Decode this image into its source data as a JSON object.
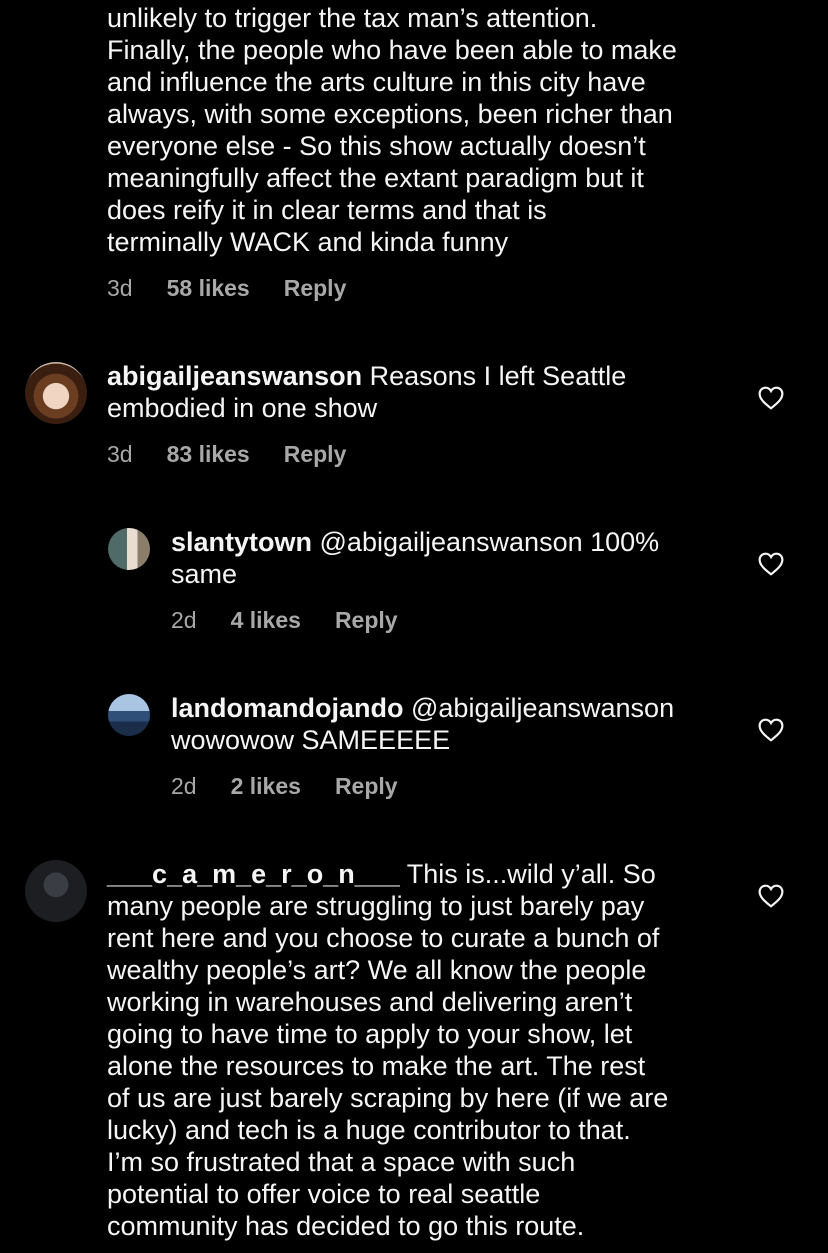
{
  "comments": [
    {
      "text": "unlikely to trigger the tax man’s attention.\nFinally, the people who have been able to make\nand influence the arts culture in this city have\nalways, with some exceptions, been richer than\neveryone else - So this show actually doesn’t\nmeaningfully affect the extant paradigm but it\ndoes reify it in clear terms and that is\nterminally WACK and kinda funny",
      "time": "3d",
      "likes": "58 likes",
      "reply": "Reply"
    },
    {
      "username": "abigailjeanswanson",
      "text": " Reasons I left Seattle\nembodied in one show",
      "time": "3d",
      "likes": "83 likes",
      "reply": "Reply",
      "icon": "heart-outline-icon"
    },
    {
      "username": "slantytown",
      "text": " @abigailjeanswanson 100%\nsame",
      "time": "2d",
      "likes": "4 likes",
      "reply": "Reply",
      "icon": "heart-outline-icon"
    },
    {
      "username": "landomandojando",
      "text": " @abigailjeanswanson\nwowowow SAMEEEEE",
      "time": "2d",
      "likes": "2 likes",
      "reply": "Reply",
      "icon": "heart-outline-icon"
    },
    {
      "username": "___c_a_m_e_r_o_n___",
      "text": " This is...wild y’all. So\nmany people are struggling to just barely pay\nrent here and you choose to curate a bunch of\nwealthy people’s art? We all know the people\nworking in warehouses and delivering aren’t\ngoing to have time to apply to your show, let\nalone the resources to make the art. The rest\nof us are just barely scraping by here (if we are\nlucky) and tech is a huge contributor to that.\nI’m so frustrated that a space with such\npotential to offer voice to real seattle\ncommunity has decided to go this route.",
      "icon": "heart-outline-icon"
    }
  ],
  "colors": {
    "background": "#000000",
    "text": "#f5f5f5",
    "meta": "#a8a8a8"
  }
}
